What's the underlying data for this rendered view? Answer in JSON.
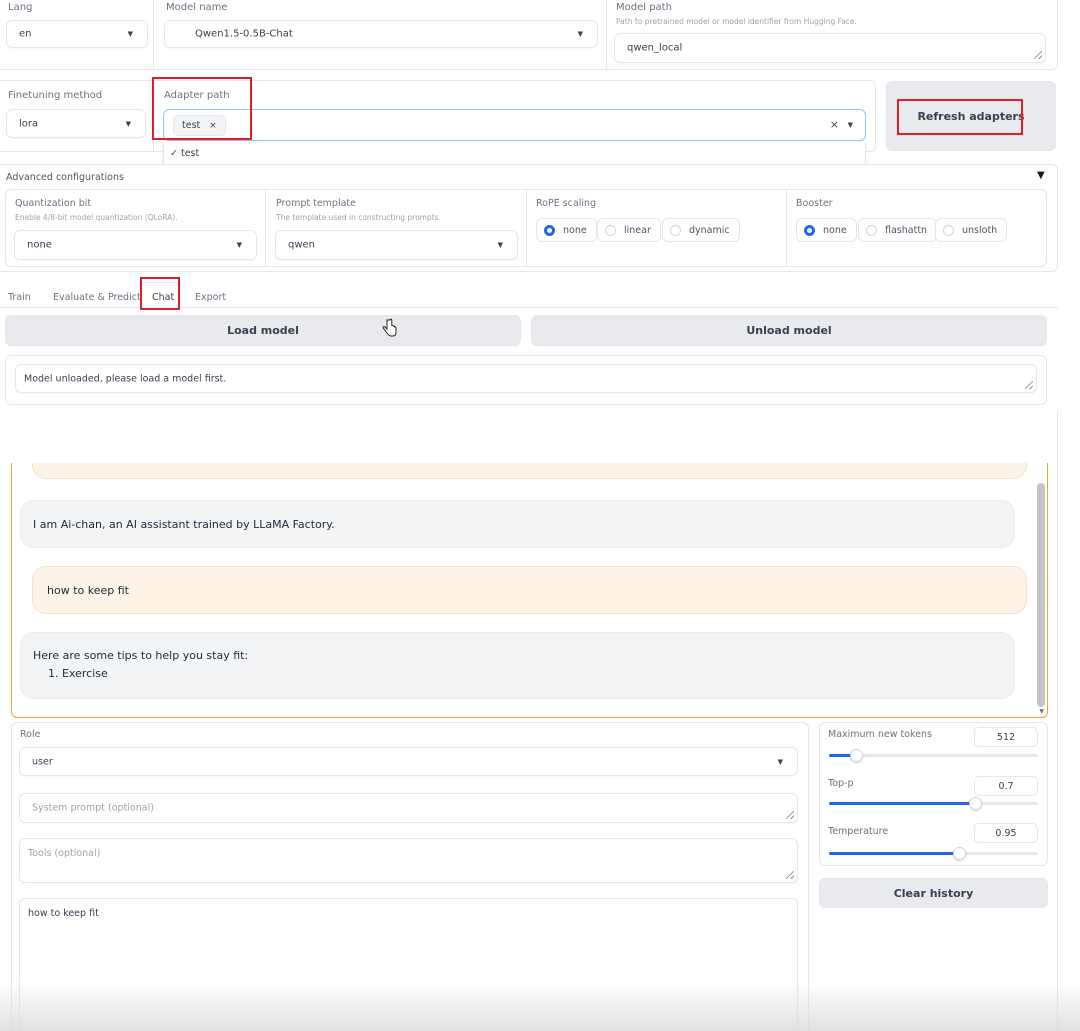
{
  "top": {
    "lang": {
      "label": "Lang",
      "value": "en"
    },
    "model_name": {
      "label": "Model name",
      "value": "Qwen1.5-0.5B-Chat"
    },
    "model_path": {
      "label": "Model path",
      "info": "Path to pretrained model or model identifier from Hugging Face.",
      "value": "qwen_local"
    }
  },
  "adapter_row": {
    "finetuning_method": {
      "label": "Finetuning method",
      "value": "lora"
    },
    "adapter_path": {
      "label": "Adapter path",
      "chip": "test",
      "chip_remove": "×",
      "clear": "×",
      "option": "✓ test"
    },
    "refresh_button": "Refresh adapters"
  },
  "advanced": {
    "title": "Advanced configurations",
    "toggle": "▼",
    "quantization": {
      "label": "Quantization bit",
      "info": "Enable 4/8-bit model quantization (QLoRA).",
      "value": "none"
    },
    "prompt_template": {
      "label": "Prompt template",
      "info": "The template used in constructing prompts.",
      "value": "qwen"
    },
    "rope": {
      "label": "RoPE scaling",
      "options": [
        "none",
        "linear",
        "dynamic"
      ],
      "selected": "none"
    },
    "booster": {
      "label": "Booster",
      "options": [
        "none",
        "flashattn",
        "unsloth"
      ],
      "selected": "none"
    }
  },
  "tabs": [
    "Train",
    "Evaluate & Predict",
    "Chat",
    "Export"
  ],
  "active_tab": "Chat",
  "load_button": "Load model",
  "unload_button": "Unload model",
  "status": "Model unloaded, please load a model first.",
  "chat": {
    "messages": [
      {
        "role": "user",
        "text": ""
      },
      {
        "role": "assistant",
        "text": "I am Ai-chan, an AI assistant trained by LLaMA Factory."
      },
      {
        "role": "user",
        "text": "how to keep fit"
      },
      {
        "role": "assistant",
        "text": "Here are some tips to help you stay fit:",
        "list_item": "1. Exercise"
      }
    ]
  },
  "controls": {
    "role": {
      "label": "Role",
      "value": "user"
    },
    "system_prompt_placeholder": "System prompt (optional)",
    "tools_placeholder": "Tools (optional)",
    "query": "how to keep fit",
    "max_new_tokens": {
      "label": "Maximum new tokens",
      "value": "512",
      "fraction": 0.13
    },
    "top_p": {
      "label": "Top-p",
      "value": "0.7",
      "fraction": 0.7
    },
    "temperature": {
      "label": "Temperature",
      "value": "0.95",
      "fraction": 0.62
    },
    "clear_button": "Clear history"
  },
  "colors": {
    "accent": "#2563eb",
    "highlight": "#e11d2a",
    "chat_border": "#f59e3f",
    "user_bubble": "#fdf4e7"
  }
}
